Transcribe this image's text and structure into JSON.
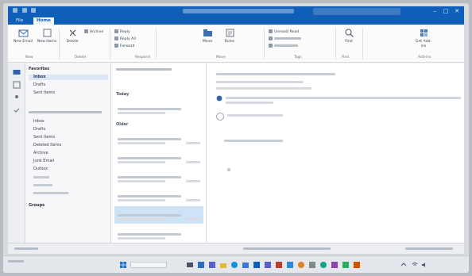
{
  "colors": {
    "accent": "#0f5fb8",
    "selected_row": "#cfe3f7",
    "selected_folder": "#dde7f5"
  },
  "titlebar": {
    "window_controls": [
      "minimize-icon",
      "maximize-icon",
      "close-icon"
    ]
  },
  "tabs": [
    {
      "label": "File",
      "active": false
    },
    {
      "label": "Home",
      "active": true
    }
  ],
  "ribbon": {
    "new_email": "New Email",
    "new_items": "New Items",
    "delete": "Delete",
    "archive": "Archive",
    "reply": "Reply",
    "reply_all": "Reply All",
    "forward": "Forward",
    "move": "Move",
    "rules": "Rules",
    "unread_read": "Unread/ Read",
    "find": "Find",
    "get_addins": "Get Add-ins",
    "groups": [
      "New",
      "Delete",
      "Respond",
      "Move",
      "Tags",
      "Find",
      "Add-ins"
    ]
  },
  "folders": {
    "favorites": "Favorites",
    "items": [
      {
        "label": "Inbox",
        "selected": true
      },
      {
        "label": "Drafts",
        "selected": false
      },
      {
        "label": "Sent Items",
        "selected": false
      }
    ],
    "account_items": [
      "Inbox",
      "Drafts",
      "Sent Items",
      "Deleted Items",
      "Archive",
      "Junk Email",
      "Outbox"
    ],
    "groups_label": "Groups"
  },
  "msglist": {
    "groups": [
      "Today",
      "Older"
    ],
    "messages": [
      {
        "group": 0,
        "from": "",
        "time": "",
        "selected": false
      },
      {
        "group": 1,
        "from": "",
        "time": "",
        "selected": false
      },
      {
        "group": 1,
        "from": "",
        "time": "",
        "selected": false
      },
      {
        "group": 1,
        "from": "",
        "time": "",
        "selected": false
      },
      {
        "group": 1,
        "from": "",
        "time": "",
        "selected": false
      },
      {
        "group": 1,
        "from": "",
        "time": "",
        "selected": true
      },
      {
        "group": 1,
        "from": "",
        "time": "",
        "selected": false
      }
    ]
  },
  "reading": {
    "subject": "",
    "body_line": ""
  },
  "taskbar": {
    "clock_time": "",
    "clock_date": ""
  }
}
